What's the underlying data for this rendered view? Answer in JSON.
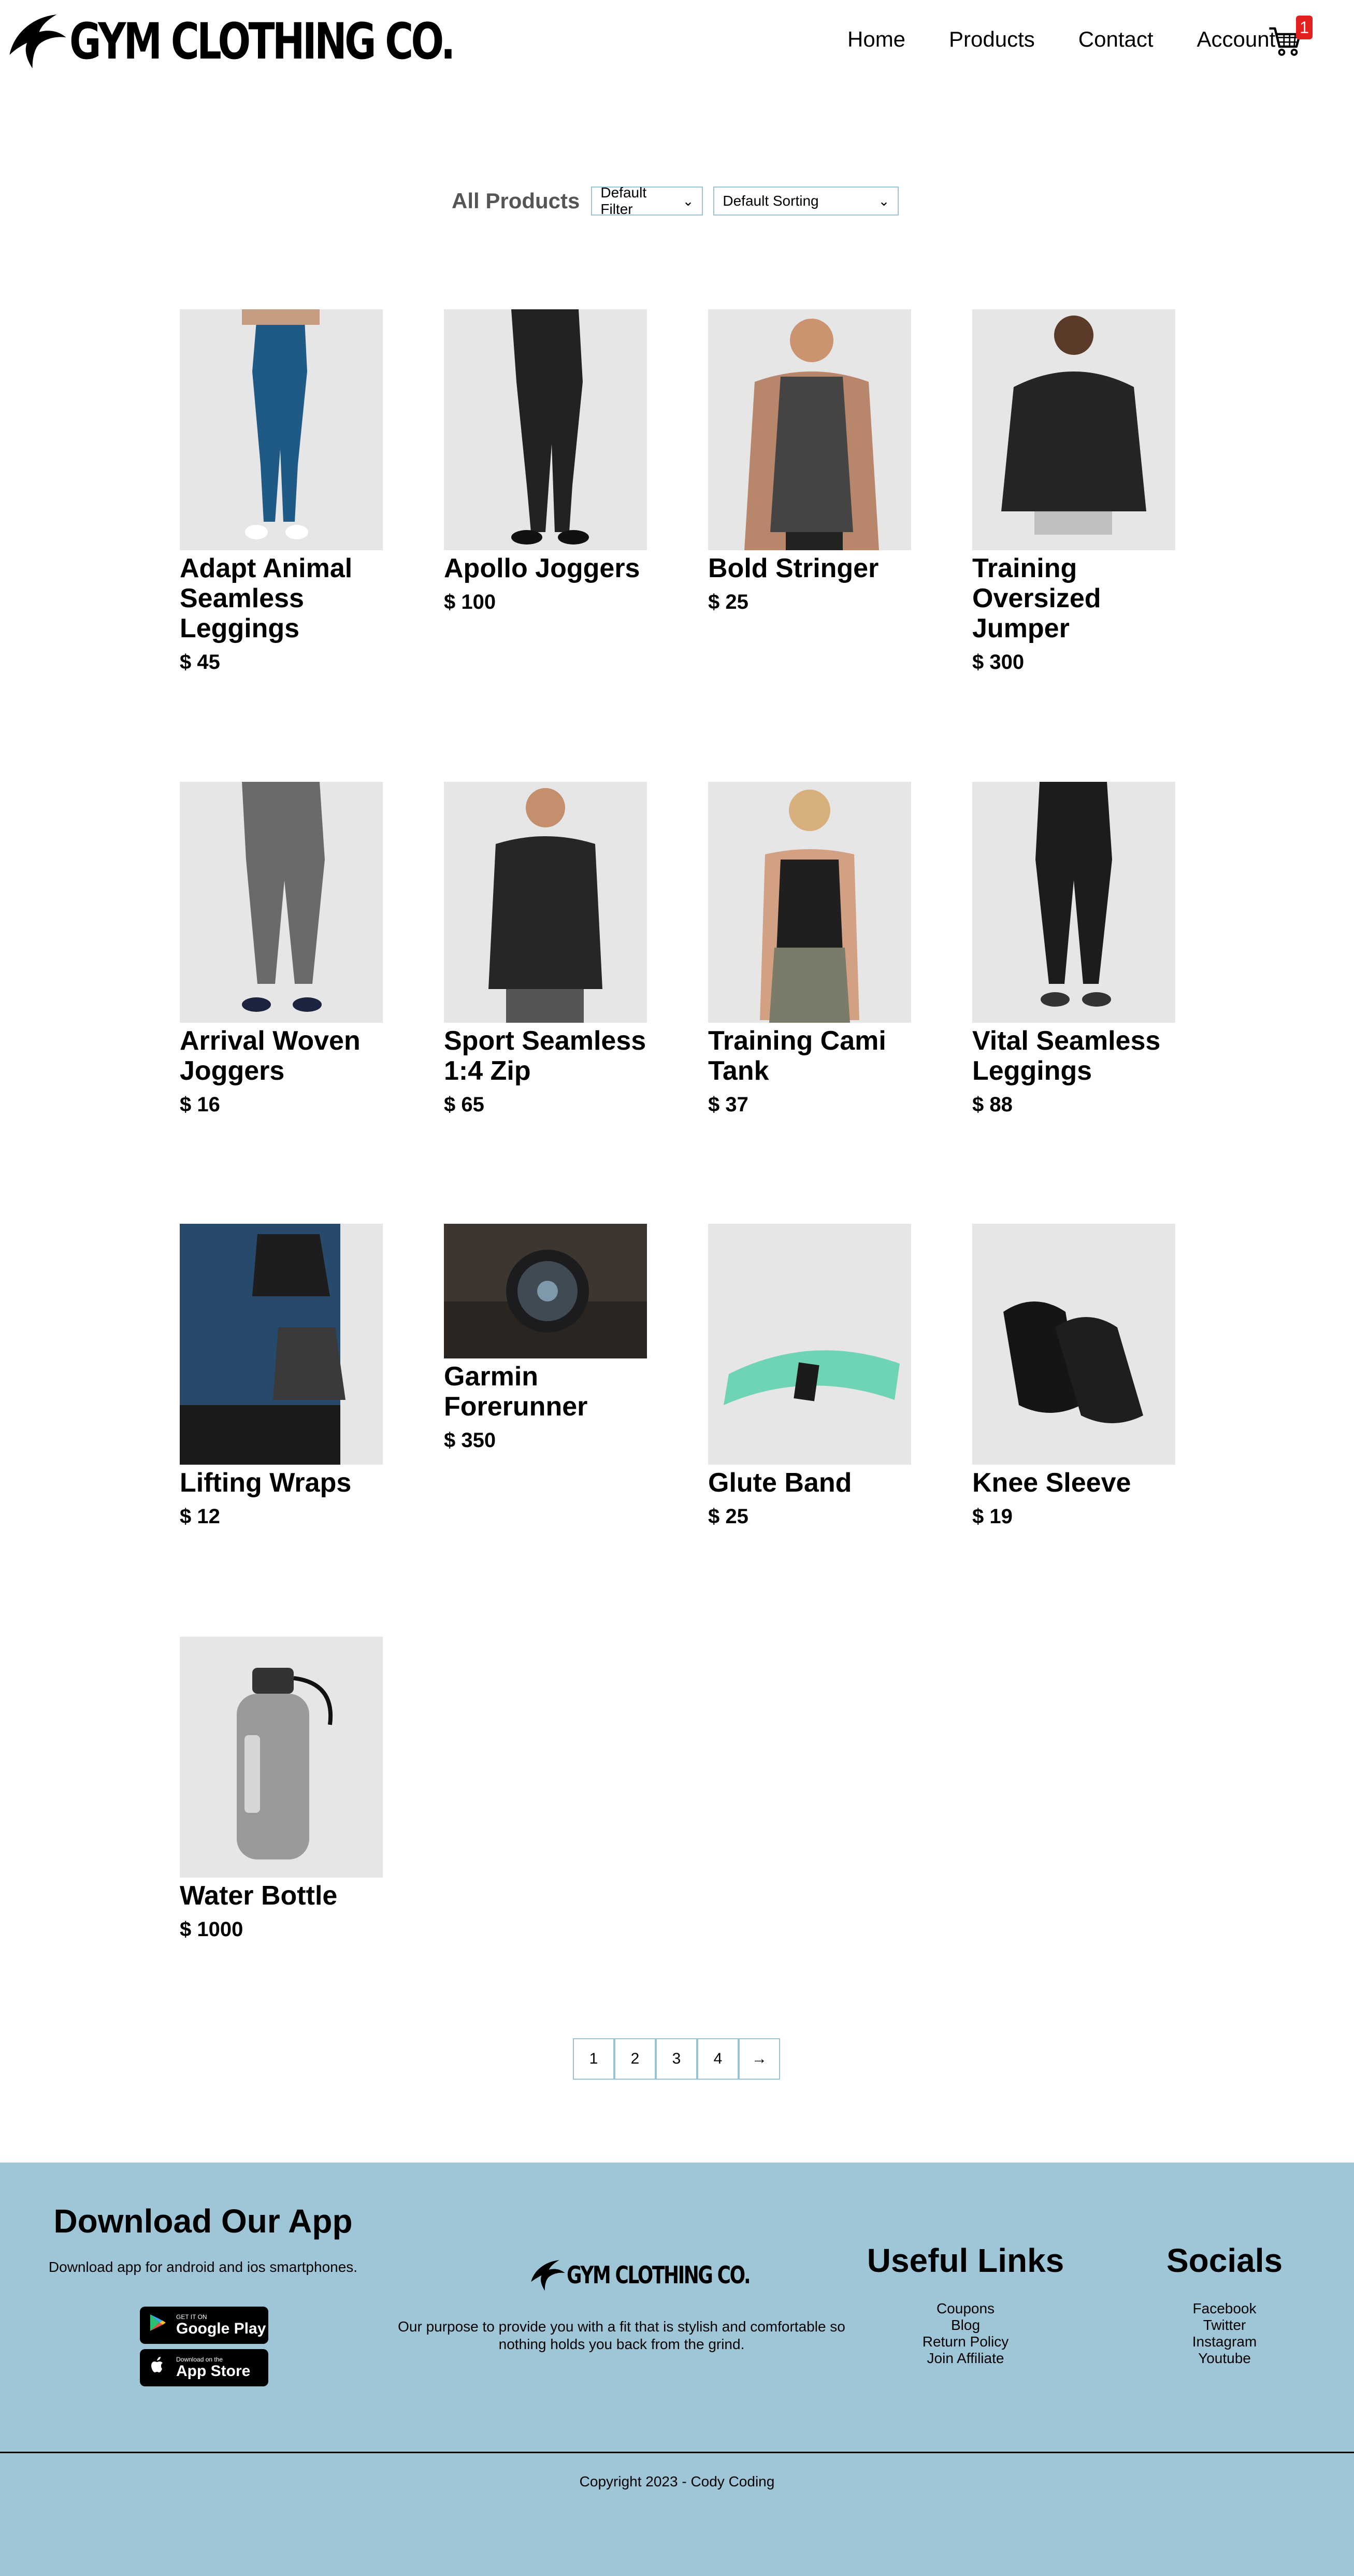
{
  "nav": {
    "brand": "GYM CLOTHING CO.",
    "links": [
      "Home",
      "Products",
      "Contact",
      "Account"
    ],
    "cart_count": "1"
  },
  "filter": {
    "title": "All Products",
    "filter_value": "Default Filter",
    "sort_value": "Default Sorting"
  },
  "products": [
    {
      "name": "Adapt Animal Seamless Leggings",
      "price": "$ 45"
    },
    {
      "name": "Apollo Joggers",
      "price": "$ 100"
    },
    {
      "name": "Bold Stringer",
      "price": "$ 25"
    },
    {
      "name": "Training Oversized Jumper",
      "price": "$ 300"
    },
    {
      "name": "Arrival Woven Joggers",
      "price": "$ 16"
    },
    {
      "name": "Sport Seamless 1:4 Zip",
      "price": "$ 65"
    },
    {
      "name": "Training Cami Tank",
      "price": "$ 37"
    },
    {
      "name": "Vital Seamless Leggings",
      "price": "$ 88"
    },
    {
      "name": "Lifting Wraps",
      "price": "$ 12"
    },
    {
      "name": "Garmin Forerunner",
      "price": "$ 350"
    },
    {
      "name": "Glute Band",
      "price": "$ 25"
    },
    {
      "name": "Knee Sleeve",
      "price": "$ 19"
    },
    {
      "name": "Water Bottle",
      "price": "$ 1000"
    }
  ],
  "pagination": [
    "1",
    "2",
    "3",
    "4",
    "→"
  ],
  "footer": {
    "app_title": "Download Our App",
    "app_sub": "Download app for android and ios smartphones.",
    "google_small": "GET IT ON",
    "google_big": "Google Play",
    "apple_small": "Download on the",
    "apple_big": "App Store",
    "brand": "GYM CLOTHING CO.",
    "purpose": "Our purpose to provide you with a fit that is stylish and comfortable so nothing holds you back from the grind.",
    "useful_title": "Useful Links",
    "useful_links": [
      "Coupons",
      "Blog",
      "Return Policy",
      "Join Affiliate"
    ],
    "socials_title": "Socials",
    "socials": [
      "Facebook",
      "Twitter",
      "Instagram",
      "Youtube"
    ],
    "copyright": "Copyright 2023 - Cody Coding"
  },
  "colors": {
    "accent": "#9fc6d7",
    "badge": "#e32020",
    "select_border": "#9ac4d4"
  },
  "icons": [
    "gym-shark-logo-icon",
    "cart-icon",
    "chevron-down-icon",
    "google-play-icon",
    "apple-icon"
  ]
}
